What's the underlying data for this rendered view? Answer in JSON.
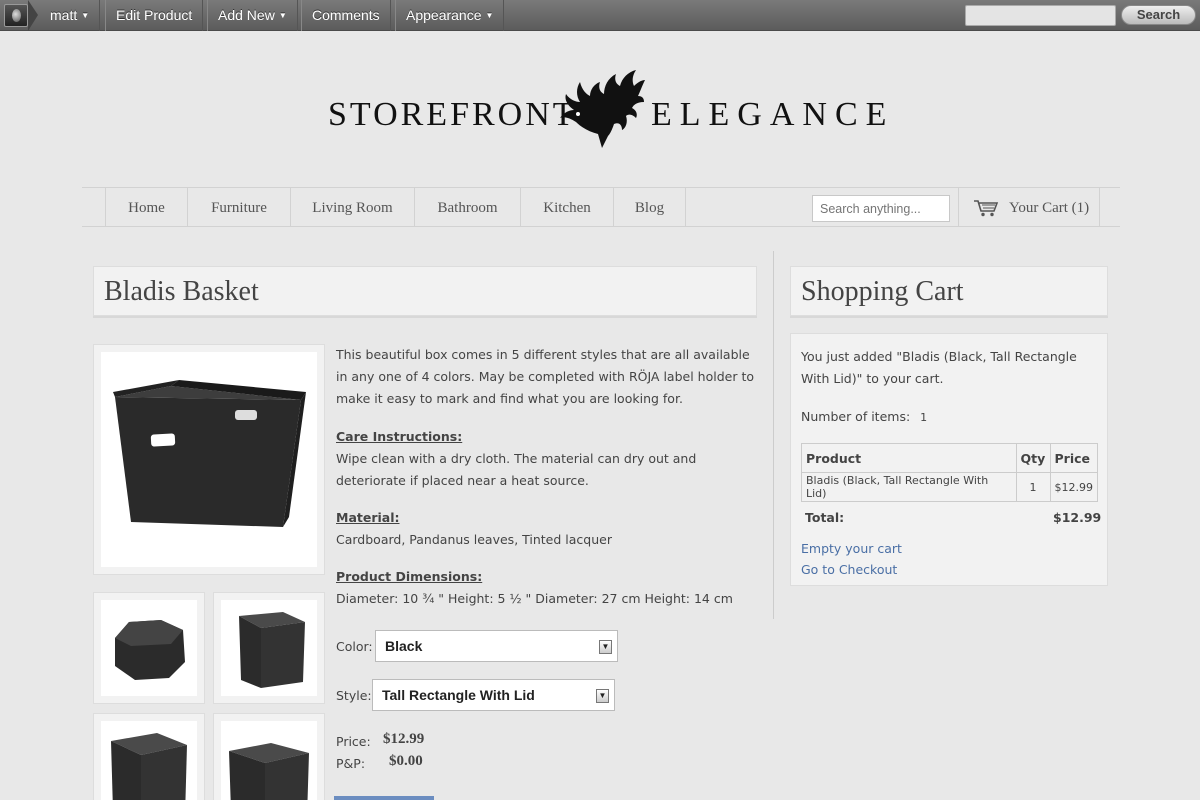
{
  "admin_bar": {
    "user": "matt",
    "edit_product": "Edit Product",
    "add_new": "Add New",
    "comments": "Comments",
    "appearance": "Appearance",
    "search_value": "",
    "search_button": "Search"
  },
  "site": {
    "logo_left": "STOREFRONT",
    "logo_right": "ELEGANCE"
  },
  "nav": {
    "items": [
      "Home",
      "Furniture",
      "Living Room",
      "Bathroom",
      "Kitchen",
      "Blog"
    ],
    "search_placeholder": "Search anything...",
    "cart_label": "Your Cart (1)"
  },
  "product": {
    "title": "Bladis Basket",
    "description": "This beautiful box comes in 5 different styles that are all available in any one of 4 colors. May be completed with RÖJA label holder to make it easy to mark and find what you are looking for.",
    "care_heading": "Care Instructions:",
    "care_text": "Wipe clean with a dry cloth. The material can dry out and deteriorate if placed near a heat source.",
    "material_heading": "Material:",
    "material_text": "Cardboard, Pandanus leaves, Tinted lacquer",
    "dimensions_heading": "Product Dimensions:",
    "dimensions_text": "Diameter: 10 ¾ \" Height: 5 ½ \" Diameter: 27 cm Height: 14 cm",
    "color_label": "Color:",
    "color_value": "Black",
    "style_label": "Style:",
    "style_value": "Tall Rectangle With Lid",
    "price_label": "Price:",
    "price_value": "$12.99",
    "pp_label": "P&P:",
    "pp_value": "$0.00"
  },
  "cart": {
    "title": "Shopping Cart",
    "added_message": "You just added \"Bladis (Black, Tall Rectangle With Lid)\" to your cart.",
    "items_label": "Number of items:",
    "items_count": "1",
    "headers": [
      "Product",
      "Qty",
      "Price"
    ],
    "rows": [
      {
        "product": "Bladis (Black, Tall Rectangle With Lid)",
        "qty": "1",
        "price": "$12.99"
      }
    ],
    "total_label": "Total:",
    "total_value": "$12.99",
    "empty_link": "Empty your cart",
    "checkout_link": "Go to Checkout"
  },
  "icons": {
    "cart": "shopping-cart-icon",
    "bird": "raven-logo-icon",
    "dropdown": "dropdown-arrow-icon"
  }
}
